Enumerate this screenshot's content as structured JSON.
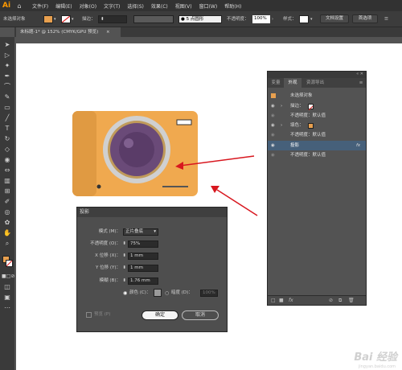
{
  "app": {
    "logo": "Ai",
    "home_icon": "home-icon"
  },
  "menu": [
    "文件(F)",
    "编辑(E)",
    "对象(O)",
    "文字(T)",
    "选择(S)",
    "效果(C)",
    "视图(V)",
    "窗口(W)",
    "帮助(H)"
  ],
  "control_bar": {
    "selection": "未选择对象",
    "fill_color": "#e8a04f",
    "stroke_label": "描边：",
    "brush_value": "5 点圆形",
    "opacity_label": "不透明度：",
    "opacity_value": "100%",
    "style_label": "样式：",
    "doc_settings": "文档设置",
    "preferences": "首选项"
  },
  "document_tab": {
    "title": "未标题-1* @ 152% (CMYK/GPU 预览)",
    "close": "×"
  },
  "appearance_panel": {
    "tabs": [
      "变量",
      "外观",
      "资源导出"
    ],
    "active_tab": 1,
    "menu_icon": "≡",
    "rows": [
      {
        "text": "未选择对象",
        "indent": 0
      },
      {
        "text": "描边：",
        "indent": 1
      },
      {
        "text": "不透明度：默认值",
        "indent": 2
      },
      {
        "text": "填色：",
        "indent": 1
      },
      {
        "text": "不透明度：默认值",
        "indent": 2
      },
      {
        "text": "投影",
        "indent": 1,
        "selected": true,
        "fx": "fx"
      },
      {
        "text": "不透明度：默认值",
        "indent": 1
      }
    ]
  },
  "drop_shadow_dialog": {
    "title": "投影",
    "mode_label": "模式 (M)：",
    "mode_value": "正片叠底",
    "opacity_label": "不透明度 (O)：",
    "opacity_value": "75%",
    "x_label": "X 位移 (X)：",
    "x_value": "1 mm",
    "y_label": "Y 位移 (Y)：",
    "y_value": "1 mm",
    "blur_label": "模糊 (B)：",
    "blur_value": "1.76 mm",
    "color_label": "颜色 (C)：",
    "darkness_label": "暗度 (D)：",
    "darkness_value": "100%",
    "preview_label": "预览 (P)",
    "ok": "确定",
    "cancel": "取消"
  },
  "colors": {
    "accent_arrow": "#d8171f",
    "camera_body": "#e8a04f",
    "lens_purple": "#6a4a78"
  },
  "watermark": {
    "logo": "Bai 经验",
    "url": "jingyan.baidu.com"
  }
}
